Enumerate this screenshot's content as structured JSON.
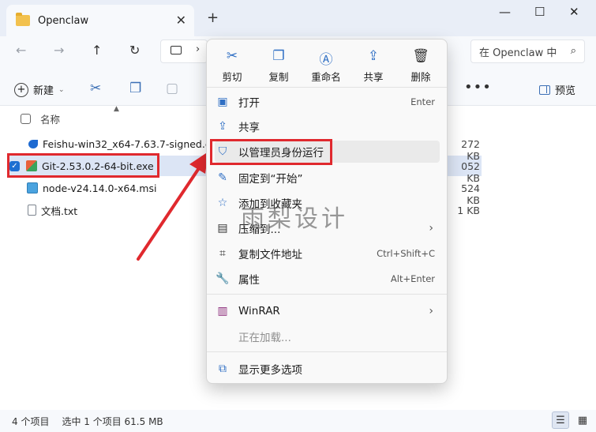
{
  "window": {
    "tab_title": "Openclaw",
    "close_tab": "✕",
    "new_tab": "+",
    "minimize": "—",
    "maximize": "☐",
    "close": "✕"
  },
  "nav": {
    "back": "←",
    "forward": "→",
    "up": "↑",
    "refresh": "↻",
    "search_placeholder": "在 Openclaw 中"
  },
  "toolbar": {
    "new_label": "新建",
    "more": "•••",
    "preview_label": "预览"
  },
  "file_list": {
    "column_name": "名称",
    "rows": [
      {
        "name": "Feishu-win32_x64-7.63.7-signed.exe",
        "size": "272 KB",
        "icon_color": "#1e6ad1"
      },
      {
        "name": "Git-2.53.0.2-64-bit.exe",
        "size": "052 KB",
        "icon_color": "#e8613c",
        "selected": true
      },
      {
        "name": "node-v24.14.0-x64.msi",
        "size": "524 KB",
        "icon_color": "#4aa3df"
      },
      {
        "name": "文档.txt",
        "size": "1 KB",
        "icon_color": "#9aa3ad"
      }
    ]
  },
  "status": {
    "count": "4 个项目",
    "selection": "选中 1 个项目  61.5 MB"
  },
  "context_menu": {
    "quick_actions": [
      {
        "label": "剪切",
        "icon": "scissors-icon"
      },
      {
        "label": "复制",
        "icon": "copy-icon"
      },
      {
        "label": "重命名",
        "icon": "rename-icon"
      },
      {
        "label": "共享",
        "icon": "share-icon"
      },
      {
        "label": "删除",
        "icon": "trash-icon"
      }
    ],
    "items": [
      {
        "label": "打开",
        "accel": "Enter"
      },
      {
        "label": "共享",
        "accel": ""
      },
      {
        "label": "以管理员身份运行",
        "accel": ""
      },
      {
        "label": "固定到“开始”",
        "accel": ""
      },
      {
        "label": "添加到收藏夹",
        "accel": ""
      },
      {
        "label": "压缩到...",
        "accel": ""
      },
      {
        "label": "复制文件地址",
        "accel": "Ctrl+Shift+C"
      },
      {
        "label": "属性",
        "accel": "Alt+Enter"
      },
      {
        "label": "WinRAR",
        "accel": ""
      },
      {
        "label": "正在加载...",
        "accel": ""
      },
      {
        "label": "显示更多选项",
        "accel": ""
      }
    ]
  },
  "watermark": "雨梨设计",
  "colors": {
    "accent": "#2f6fc4",
    "highlight_red": "#e0292e",
    "selection": "#dce5f5"
  }
}
